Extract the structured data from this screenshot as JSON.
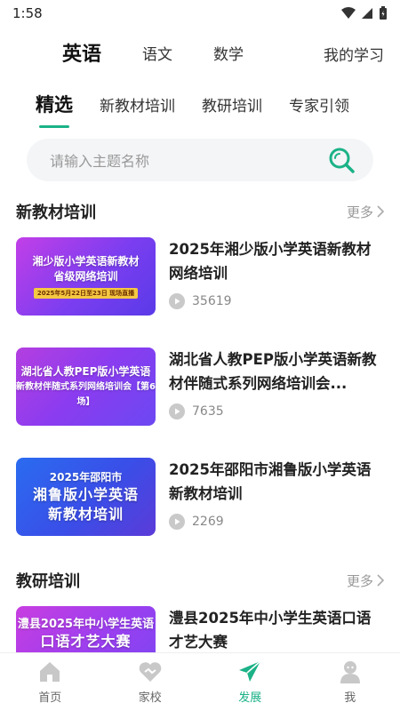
{
  "status": {
    "time": "1:58"
  },
  "subjects": {
    "english": "英语",
    "chinese": "语文",
    "math": "数学",
    "my_study": "我的学习"
  },
  "categories": {
    "featured": "精选",
    "new_textbook": "新教材培训",
    "research": "教研培训",
    "expert": "专家引领"
  },
  "search": {
    "placeholder": "请输入主题名称"
  },
  "sections": [
    {
      "title": "新教材培训",
      "more": "更多"
    },
    {
      "title": "教研培训",
      "more": "更多"
    }
  ],
  "items": [
    {
      "title": "2025年湘少版小学英语新教材网络培训",
      "views": "35619",
      "thumb": {
        "line1": "湘少版小学英语新教材",
        "line2": "省级网络培训",
        "badge": "2025年5月22日至23日 现场直播"
      }
    },
    {
      "title": "湖北省人教PEP版小学英语新教材伴随式系列网络培训会...",
      "views": "7635",
      "thumb": {
        "line1": "湖北省人教PEP版小学英语",
        "line2": "新教材伴随式系列网络培训会【第6场】"
      }
    },
    {
      "title": "2025年邵阳市湘鲁版小学英语新教材培训",
      "views": "2269",
      "thumb": {
        "line1": "2025年邵阳市",
        "big1": "湘鲁版小学英语",
        "big2": "新教材培训"
      }
    },
    {
      "title": "澧县2025年中小学生英语口语才艺大赛",
      "views": "",
      "thumb": {
        "big1": "澧县2025年中小学生英语",
        "big2": "口语才艺大赛"
      }
    }
  ],
  "nav": {
    "home": "首页",
    "family": "家校",
    "develop": "发展",
    "me": "我"
  },
  "colors": {
    "accent": "#1bb287"
  }
}
